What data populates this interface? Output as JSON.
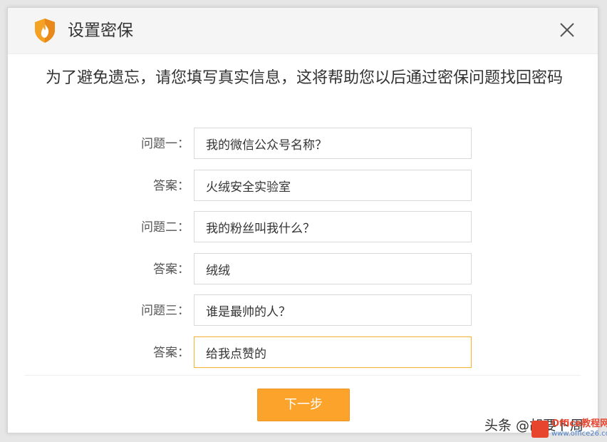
{
  "dialog": {
    "title": "设置密保",
    "subtitle": "为了避免遗忘，请您填写真实信息，这将帮助您以后通过密保问题找回密码",
    "close_icon": "close-icon",
    "shield_icon": "shield-flame-icon",
    "brand_color": "#fca32b"
  },
  "form": {
    "rows": [
      {
        "label": "问题一：",
        "value": "我的微信公众号名称？"
      },
      {
        "label": "答案：",
        "value": "火绒安全实验室"
      },
      {
        "label": "问题二：",
        "value": "我的粉丝叫我什么？"
      },
      {
        "label": "答案：",
        "value": "绒绒"
      },
      {
        "label": "问题三：",
        "value": "谁是最帅的人？"
      },
      {
        "label": "答案：",
        "value": "给我点赞的"
      }
    ]
  },
  "footer": {
    "next_label": "下一步"
  },
  "watermark": {
    "text": "头条 @胡要卜周",
    "site_name": "Office教程网",
    "site_url": "www.office26.com"
  }
}
